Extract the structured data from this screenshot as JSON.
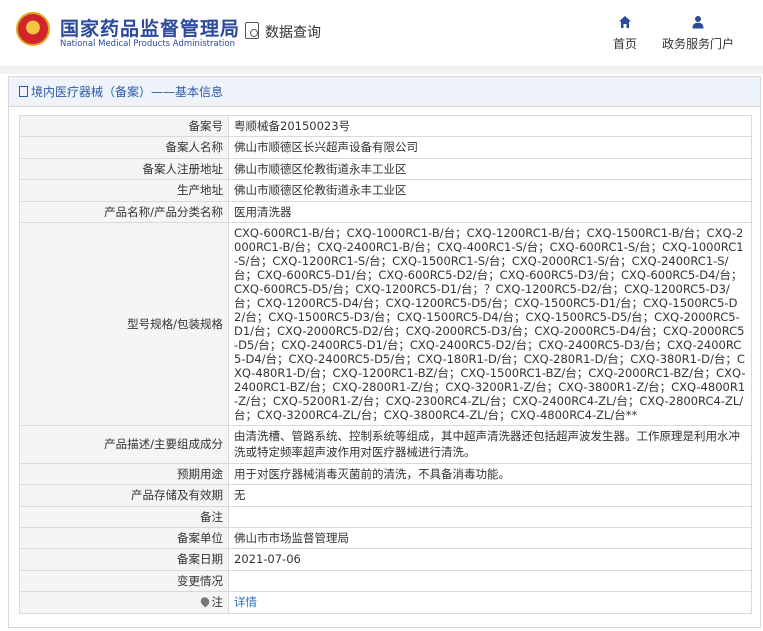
{
  "header": {
    "brand_cn": "国家药品监督管理局",
    "brand_en": "National Medical Products Administration",
    "query_label": "数据查询",
    "nav": [
      {
        "label": "首页",
        "icon": "home-icon"
      },
      {
        "label": "政务服务门户",
        "icon": "user-icon"
      }
    ]
  },
  "panel": {
    "title": "境内医疗器械（备案）——基本信息"
  },
  "rows": [
    {
      "key": "备案号",
      "value": "粤顺械备20150023号"
    },
    {
      "key": "备案人名称",
      "value": "佛山市顺德区长兴超声设备有限公司"
    },
    {
      "key": "备案人注册地址",
      "value": "佛山市顺德区伦教街道永丰工业区"
    },
    {
      "key": "生产地址",
      "value": "佛山市顺德区伦教街道永丰工业区"
    },
    {
      "key": "产品名称/产品分类名称",
      "value": "医用清洗器"
    },
    {
      "key": "型号规格/包装规格",
      "value": "CXQ-600RC1-B/台；CXQ-1000RC1-B/台；CXQ-1200RC1-B/台；CXQ-1500RC1-B/台；CXQ-2000RC1-B/台；CXQ-2400RC1-B/台；CXQ-400RC1-S/台；CXQ-600RC1-S/台；CXQ-1000RC1-S/台；CXQ-1200RC1-S/台；CXQ-1500RC1-S/台；CXQ-2000RC1-S/台；CXQ-2400RC1-S/台；CXQ-600RC5-D1/台；CXQ-600RC5-D2/台；CXQ-600RC5-D3/台；CXQ-600RC5-D4/台；CXQ-600RC5-D5/台；CXQ-1200RC5-D1/台；？CXQ-1200RC5-D2/台；CXQ-1200RC5-D3/台；CXQ-1200RC5-D4/台；CXQ-1200RC5-D5/台；CXQ-1500RC5-D1/台；CXQ-1500RC5-D2/台；CXQ-1500RC5-D3/台；CXQ-1500RC5-D4/台；CXQ-1500RC5-D5/台；CXQ-2000RC5-D1/台；CXQ-2000RC5-D2/台；CXQ-2000RC5-D3/台；CXQ-2000RC5-D4/台；CXQ-2000RC5-D5/台；CXQ-2400RC5-D1/台；CXQ-2400RC5-D2/台；CXQ-2400RC5-D3/台；CXQ-2400RC5-D4/台；CXQ-2400RC5-D5/台；CXQ-180R1-D/台；CXQ-280R1-D/台；CXQ-380R1-D/台；CXQ-480R1-D/台；CXQ-1200RC1-BZ/台；CXQ-1500RC1-BZ/台；CXQ-2000RC1-BZ/台；CXQ-2400RC1-BZ/台；CXQ-2800R1-Z/台；CXQ-3200R1-Z/台；CXQ-3800R1-Z/台；CXQ-4800R1-Z/台；CXQ-5200R1-Z/台；CXQ-2300RC4-ZL/台；CXQ-2400RC4-ZL/台；CXQ-2800RC4-ZL/台；CXQ-3200RC4-ZL/台；CXQ-3800RC4-ZL/台；CXQ-4800RC4-ZL/台**"
    },
    {
      "key": "产品描述/主要组成成分",
      "value": "由清洗槽、管路系统、控制系统等组成，其中超声清洗器还包括超声波发生器。工作原理是利用水冲洗或特定频率超声波作用对医疗器械进行清洗。"
    },
    {
      "key": "预期用途",
      "value": "用于对医疗器械消毒灭菌前的清洗，不具备消毒功能。"
    },
    {
      "key": "产品存储及有效期",
      "value": "无"
    },
    {
      "key": "备注",
      "value": ""
    },
    {
      "key": "备案单位",
      "value": "佛山市市场监督管理局"
    },
    {
      "key": "备案日期",
      "value": "2021-07-06"
    },
    {
      "key": "变更情况",
      "value": ""
    },
    {
      "key": "注",
      "value": "详情"
    }
  ]
}
